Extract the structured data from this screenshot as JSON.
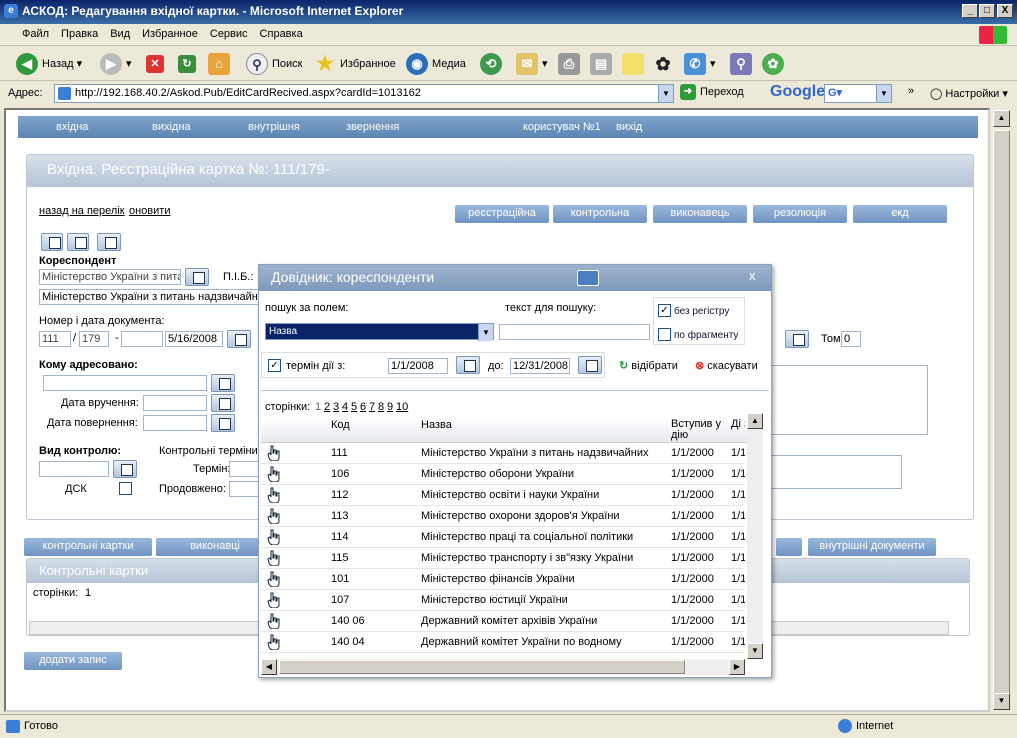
{
  "window": {
    "title": "АСКОД: Редагування вхідної картки. - Microsoft Internet Explorer",
    "min": "_",
    "max": "□",
    "close": "X"
  },
  "menu": [
    "Файл",
    "Правка",
    "Вид",
    "Избранное",
    "Сервис",
    "Справка"
  ],
  "toolbar": {
    "back": "Назад",
    "search": "Поиск",
    "favorites": "Избранное",
    "media": "Медиа"
  },
  "address": {
    "label": "Адрес:",
    "url": "http://192.168.40.2/Askod.Pub/EditCardRecived.aspx?cardId=1013162",
    "go": "Переход",
    "google": "Google",
    "settings": "Настройки"
  },
  "nav": {
    "items": [
      "вхідна",
      "вихідна",
      "внутрішня",
      "звернення"
    ],
    "user": "користувач №1",
    "exit": "вихід"
  },
  "card": {
    "title": "Вхідна. Реєстраційна картка №: 111/179-",
    "back_link": "назад на перелік",
    "refresh_link": "оновити",
    "tabs": [
      "реєстраційна",
      "контрольна",
      "виконавець",
      "резолюція",
      "екд"
    ],
    "correspondent_label": "Кореспондент",
    "correspondent_short": "Міністерство України з пита",
    "pib_label": "П.І.Б.:",
    "correspondent_full": "Міністерство України з питань надзвичайн",
    "docnum_label": "Номер і дата документа:",
    "num1": "111",
    "num2": "179",
    "doc_date": "5/16/2008",
    "volume_label": "Том:",
    "volume": "0",
    "addressed_label": "Кому адресовано:",
    "delivery_label": "Дата вручення:",
    "return_label": "Дата повернення:",
    "control_type_label": "Вид контролю:",
    "dsk_label": "ДСК",
    "control_terms_label": "Контрольні терміни",
    "term_label": "Термін:",
    "extended_label": "Продовжено:"
  },
  "bottom": {
    "tabs": [
      "контрольні картки",
      "виконавці",
      "внутрішні документи"
    ],
    "panel_title": "Контрольні картки",
    "pages_label": "сторінки:",
    "pages_value": "1",
    "add_button": "додати запис"
  },
  "modal": {
    "title": "Довідник: кореспонденти",
    "close": "x",
    "search_field_label": "пошук за полем:",
    "search_field_value": "Назва",
    "search_text_label": "текст для пошуку:",
    "case_label": "без регістру",
    "fragment_label": "по фрагменту",
    "term_label": "термін дії з:",
    "date_from": "1/1/2008",
    "to_label": "до:",
    "date_to": "12/31/2008",
    "select_button": "відібрати",
    "cancel_button": "скасувати",
    "pages_label": "сторінки:",
    "pages": [
      "1",
      "2",
      "3",
      "4",
      "5",
      "6",
      "7",
      "8",
      "9",
      "10"
    ],
    "columns": [
      "Код",
      "Назва",
      "Вступив у дію",
      "Ді зак"
    ],
    "rows": [
      {
        "code": "111",
        "name": "Міністерство України з питань надзвичайних",
        "date": "1/1/2000",
        "end": "1/1"
      },
      {
        "code": "106",
        "name": "Міністерство оборони України",
        "date": "1/1/2000",
        "end": "1/1"
      },
      {
        "code": "112",
        "name": "Міністерство освіти і науки України",
        "date": "1/1/2000",
        "end": "1/1"
      },
      {
        "code": "113",
        "name": "Міністерство охорони здоров'я України",
        "date": "1/1/2000",
        "end": "1/1"
      },
      {
        "code": "114",
        "name": "Міністерство праці та соціальної політики",
        "date": "1/1/2000",
        "end": "1/1"
      },
      {
        "code": "115",
        "name": "Міністерство транспорту і зв\"язку України",
        "date": "1/1/2000",
        "end": "1/1"
      },
      {
        "code": "101",
        "name": "Міністерство фінансів  України",
        "date": "1/1/2000",
        "end": "1/1"
      },
      {
        "code": "107",
        "name": "Міністерство юстиції України",
        "date": "1/1/2000",
        "end": "1/1"
      },
      {
        "code": "140 06",
        "name": "Державний комітет архівів України",
        "date": "1/1/2000",
        "end": "1/1"
      },
      {
        "code": "140 04",
        "name": "Державний комітет України по водному",
        "date": "1/1/2000",
        "end": "1/1"
      }
    ]
  },
  "status": {
    "left": "Готово",
    "zone": "Internet"
  }
}
